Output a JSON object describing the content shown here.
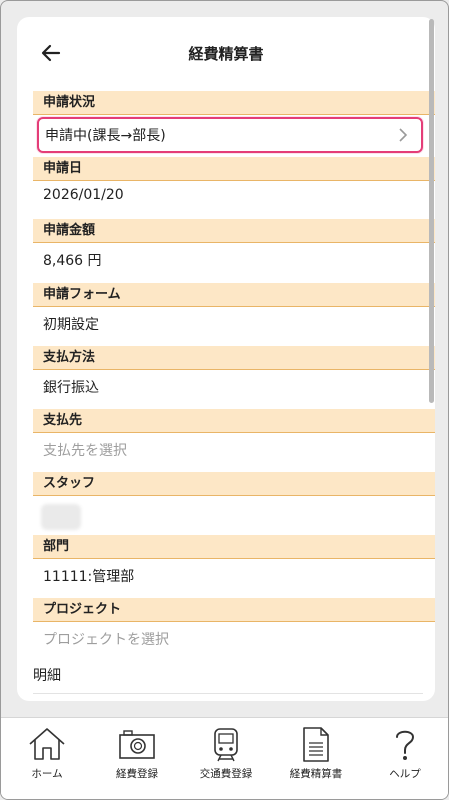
{
  "header": {
    "title": "経費精算書"
  },
  "fields": [
    {
      "label": "申請状況",
      "value": "申請中(課長→部長)"
    },
    {
      "label": "申請日",
      "value": "2026/01/20"
    },
    {
      "label": "申請金額",
      "value": "8,466 円"
    },
    {
      "label": "申請フォーム",
      "value": "初期設定"
    },
    {
      "label": "支払方法",
      "value": "銀行振込"
    },
    {
      "label": "支払先",
      "placeholder": "支払先を選択"
    },
    {
      "label": "スタッフ"
    },
    {
      "label": "部門",
      "value": "11111:管理部"
    },
    {
      "label": "プロジェクト",
      "placeholder": "プロジェクトを選択"
    }
  ],
  "details": {
    "label": "明細"
  },
  "tabs": [
    {
      "label": "ホーム",
      "icon": "home-icon"
    },
    {
      "label": "経費登録",
      "icon": "camera-icon"
    },
    {
      "label": "交通費登録",
      "icon": "train-icon"
    },
    {
      "label": "経費精算書",
      "icon": "document-icon"
    },
    {
      "label": "ヘルプ",
      "icon": "help-icon"
    }
  ]
}
